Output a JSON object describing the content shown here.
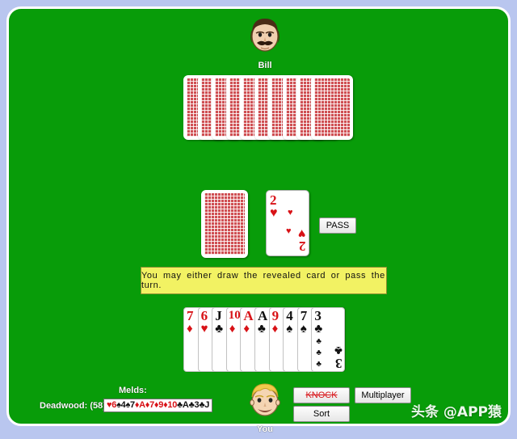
{
  "colors": {
    "felt": "#089c09",
    "page_background": "#b9c6ef",
    "table_border": "#ffffff",
    "banner_background": "#f2f263",
    "red_suit": "#d81217",
    "black_suit": "#111111",
    "knock_disabled": "#d81217"
  },
  "opponent": {
    "name": "Bill",
    "avatar_icon": "male-avatar-mustache-icon",
    "hand_card_count": 10,
    "hand_face_down": true
  },
  "player": {
    "name": "You",
    "avatar_icon": "male-avatar-blond-icon",
    "hand": [
      {
        "rank": "7",
        "suit": "♦",
        "color": "red",
        "suit_name": "diamonds"
      },
      {
        "rank": "6",
        "suit": "♥",
        "color": "red",
        "suit_name": "hearts"
      },
      {
        "rank": "J",
        "suit": "♣",
        "color": "black",
        "suit_name": "clubs"
      },
      {
        "rank": "10",
        "suit": "♦",
        "color": "red",
        "suit_name": "diamonds"
      },
      {
        "rank": "A",
        "suit": "♦",
        "color": "red",
        "suit_name": "diamonds"
      },
      {
        "rank": "A",
        "suit": "♣",
        "color": "black",
        "suit_name": "clubs"
      },
      {
        "rank": "9",
        "suit": "♦",
        "color": "red",
        "suit_name": "diamonds"
      },
      {
        "rank": "4",
        "suit": "♠",
        "color": "black",
        "suit_name": "spades"
      },
      {
        "rank": "7",
        "suit": "♠",
        "color": "black",
        "suit_name": "spades"
      },
      {
        "rank": "3",
        "suit": "♣",
        "color": "black",
        "suit_name": "clubs"
      }
    ]
  },
  "piles": {
    "stock": {
      "face_down": true,
      "label": "stock-pile"
    },
    "discard": {
      "rank": "2",
      "suit": "♥",
      "color": "red",
      "suit_name": "hearts",
      "face_up": true
    }
  },
  "banner": {
    "message": "You may either draw the revealed card or pass the turn."
  },
  "buttons": {
    "pass": "PASS",
    "knock": "KNOCK",
    "knock_disabled": true,
    "multiplayer": "Multiplayer",
    "sort": "Sort"
  },
  "status": {
    "melds_label": "Melds:",
    "melds_cards": "",
    "deadwood_label": "Deadwood: (58)",
    "deadwood_cards": [
      {
        "suit": "♥",
        "rank": "6",
        "color": "red"
      },
      {
        "suit": "♠",
        "rank": "4",
        "color": "black"
      },
      {
        "suit": "♠",
        "rank": "7",
        "color": "black"
      },
      {
        "suit": "♦",
        "rank": "A",
        "color": "red"
      },
      {
        "suit": "♦",
        "rank": "7",
        "color": "red"
      },
      {
        "suit": "♦",
        "rank": "9",
        "color": "red"
      },
      {
        "suit": "♦",
        "rank": "10",
        "color": "red"
      },
      {
        "suit": "♣",
        "rank": "A",
        "color": "black"
      },
      {
        "suit": "♣",
        "rank": "3",
        "color": "black"
      },
      {
        "suit": "♣",
        "rank": "J",
        "color": "black"
      }
    ]
  },
  "watermark": {
    "text": "头条 @APP猿"
  }
}
